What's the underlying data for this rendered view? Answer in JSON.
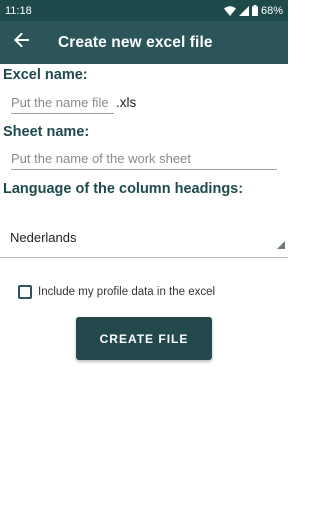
{
  "status_bar": {
    "time": "11:18",
    "battery": "68%",
    "icons": [
      "wifi-icon",
      "signal-icon",
      "battery-icon"
    ]
  },
  "app_bar": {
    "back_icon": "arrow-left-icon",
    "title": "Create new excel file",
    "color": "#2b5558"
  },
  "form": {
    "excel_name": {
      "label": "Excel name:",
      "placeholder": "Put the name file",
      "value": "",
      "suffix": ".xls"
    },
    "sheet_name": {
      "label": "Sheet name:",
      "placeholder": "Put the name of the work sheet",
      "value": ""
    },
    "language": {
      "label": "Language of the column headings:",
      "selected": "Nederlands"
    },
    "include_profile": {
      "label": "Include my profile data in the excel",
      "checked": false
    },
    "create_button": "CREATE FILE"
  }
}
